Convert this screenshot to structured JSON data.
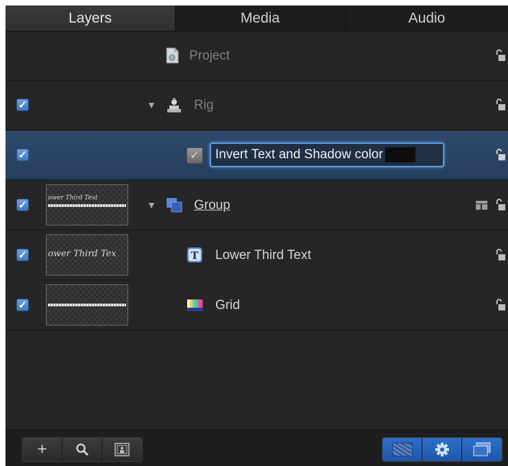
{
  "tabs": [
    {
      "label": "Layers",
      "active": true
    },
    {
      "label": "Media",
      "active": false
    },
    {
      "label": "Audio",
      "active": false
    }
  ],
  "rows": {
    "project": {
      "label": "Project"
    },
    "rig": {
      "label": "Rig",
      "checked": true
    },
    "widget": {
      "label": "Invert Text and Shadow color",
      "checked": true,
      "editing": true
    },
    "group": {
      "label": "Group",
      "checked": true,
      "thumb_text": "ower Third Text"
    },
    "lower_third": {
      "label": "Lower Third Text",
      "checked": true,
      "thumb_text": "ower Third Tex"
    },
    "grid": {
      "label": "Grid",
      "checked": true
    }
  },
  "toolbar": {
    "add_label": "+",
    "search_icon": "search-icon",
    "thumbnail_icon": "thumbnail-icon",
    "right_icons": [
      "transparency-grid-icon",
      "gear-icon",
      "layers-stack-icon"
    ]
  },
  "colors": {
    "panel_bg": "#262626",
    "selected_row": "#2b4464",
    "accent": "#3f79c0"
  }
}
